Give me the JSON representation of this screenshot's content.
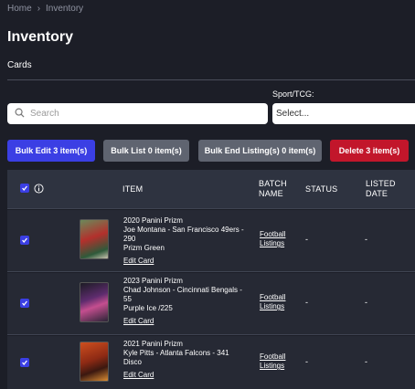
{
  "breadcrumb": {
    "home": "Home",
    "separator": "›",
    "current": "Inventory"
  },
  "page": {
    "title": "Inventory",
    "section": "Cards"
  },
  "search": {
    "placeholder": "Search",
    "value": ""
  },
  "sport_filter": {
    "label": "Sport/TCG:",
    "selected": "Select..."
  },
  "actions": {
    "bulk_edit": "Bulk Edit 3 item(s)",
    "bulk_list": "Bulk List 0 item(s)",
    "bulk_end": "Bulk End Listing(s) 0 item(s)",
    "delete": "Delete 3 item(s)"
  },
  "table": {
    "headers": {
      "item": "ITEM",
      "batch_line1": "BATCH",
      "batch_line2": "NAME",
      "status": "STATUS",
      "listed_line1": "LISTED",
      "listed_line2": "DATE"
    },
    "rows": [
      {
        "title_line1": "2020 Panini Prizm",
        "title_line2": "Joe Montana - San Francisco 49ers - 290",
        "title_line3": "Prizm Green",
        "edit": "Edit Card",
        "batch_line1": "Football",
        "batch_line2": "Listings",
        "status": "-",
        "listed": "-",
        "checked": true
      },
      {
        "title_line1": "2023 Panini Prizm",
        "title_line2": "Chad Johnson - Cincinnati Bengals - 55",
        "title_line3": "Purple Ice /225",
        "edit": "Edit Card",
        "batch_line1": "Football",
        "batch_line2": "Listings",
        "status": "-",
        "listed": "-",
        "checked": true
      },
      {
        "title_line1": "2021 Panini Prizm",
        "title_line2": "Kyle Pitts - Atlanta Falcons - 341",
        "title_line3": "Disco",
        "edit": "Edit Card",
        "batch_line1": "Football",
        "batch_line2": "Listings",
        "status": "-",
        "listed": "-",
        "checked": true
      }
    ]
  },
  "colors": {
    "background": "#1c1e27",
    "primary": "#3b3fe4",
    "secondary": "#5f6470",
    "danger": "#c2162b"
  }
}
